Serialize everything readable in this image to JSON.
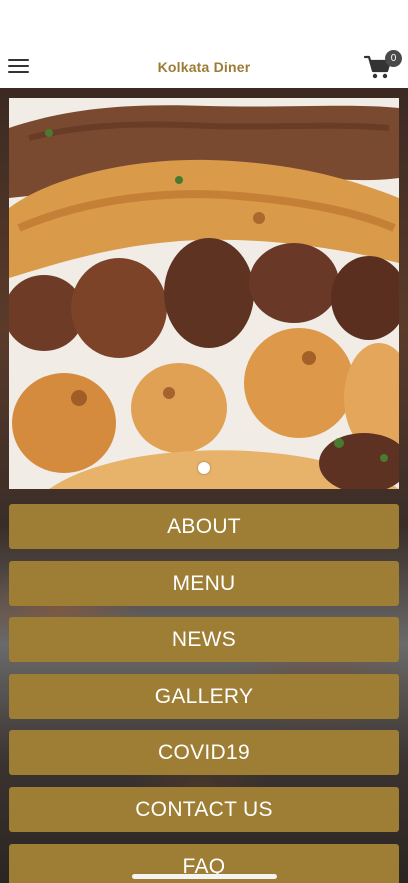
{
  "header": {
    "title": "Kolkata Diner",
    "cart_count": "0"
  },
  "hero": {
    "image_description": "grilled kebab platter",
    "carousel_active_index": 0,
    "carousel_count": 1
  },
  "menu": {
    "items": [
      {
        "label": "ABOUT"
      },
      {
        "label": "MENU"
      },
      {
        "label": "NEWS"
      },
      {
        "label": "GALLERY"
      },
      {
        "label": "COVID19"
      },
      {
        "label": "CONTACT US"
      },
      {
        "label": "FAQ"
      }
    ]
  },
  "colors": {
    "accent": "#9e7e35",
    "title": "#9c7c34"
  }
}
